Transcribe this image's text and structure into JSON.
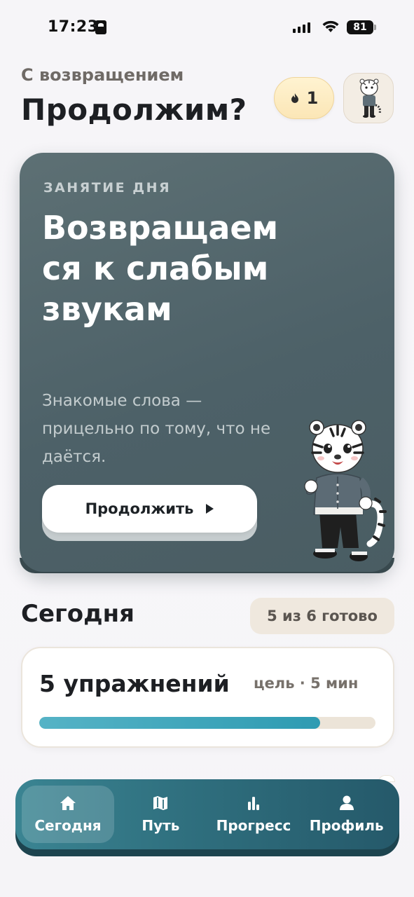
{
  "status_bar": {
    "time": "17:23",
    "battery": "81"
  },
  "header": {
    "greeting": "С возвращением",
    "title": "Продолжим?",
    "streak_count": "1"
  },
  "hero": {
    "eyebrow": "ЗАНЯТИЕ ДНЯ",
    "title": "Возвращаем ся к слабым звукам",
    "subtitle": "Знакомые слова — прицельно по тому, что не даётся.",
    "cta_label": "Продолжить"
  },
  "today": {
    "title": "Сегодня",
    "badge": "5 из 6 готово",
    "exercise_title": "5 упражнений",
    "exercise_goal": "цель · 5 мин",
    "progress": 0.835
  },
  "tabbar": {
    "tabs": [
      {
        "label": "Сегодня",
        "icon": "home-icon",
        "active": true
      },
      {
        "label": "Путь",
        "icon": "map-icon",
        "active": false
      },
      {
        "label": "Прогресс",
        "icon": "bar-chart-icon",
        "active": false
      },
      {
        "label": "Профиль",
        "icon": "user-icon",
        "active": false
      }
    ]
  },
  "colors": {
    "accent": "#2f6f7e",
    "hero_bg": "#4d6168",
    "progress_fill": "#2e9bb2",
    "streak_bg": "#fbe6b6"
  }
}
